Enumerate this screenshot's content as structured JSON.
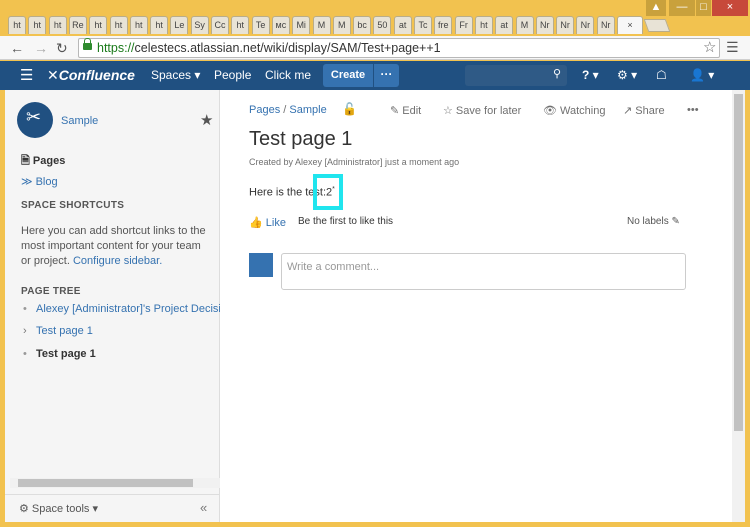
{
  "browser": {
    "tabs": [
      "ht",
      "ht",
      "ht",
      "Re",
      "ht",
      "ht",
      "ht",
      "ht",
      "Le",
      "Sy",
      "Cc",
      "ht",
      "Te",
      "мс",
      "Mi",
      "M",
      "M",
      "bc",
      "50",
      "at",
      "Tc",
      "fre",
      "Fr",
      "ht",
      "at",
      "M",
      "Nr",
      "Nr",
      "Nr",
      "Nr"
    ],
    "active_tab_close": "×",
    "url_scheme": "https://",
    "url_rest": "celestecs.atlassian.net/wiki/display/SAM/Test+page++1",
    "window_controls": [
      "▲",
      "—",
      "□",
      "×"
    ]
  },
  "header": {
    "logo": "Confluence",
    "spaces": "Spaces ▾",
    "people": "People",
    "click_me": "Click me",
    "create": "Create",
    "create_more": "···",
    "help": "? ▾",
    "settings": "⚙ ▾",
    "notifications": "☖",
    "user": "👤 ▾"
  },
  "sidebar": {
    "space_name": "Sample",
    "pages": "Pages",
    "blog": "Blog",
    "shortcuts_heading": "SPACE SHORTCUTS",
    "shortcuts_text": "Here you can add shortcut links to the most important content for your team or project.",
    "configure_sidebar": "Configure sidebar.",
    "page_tree_heading": "PAGE TREE",
    "tree_items": [
      "Alexey [Administrator]'s Project Decisio",
      "Test page 1",
      "Test page 1"
    ],
    "space_tools": "Space tools ▾",
    "collapse": "«"
  },
  "page": {
    "breadcrumb_pages": "Pages",
    "breadcrumb_sep": "/",
    "breadcrumb_space": "Sample",
    "edit": "Edit",
    "save_for_later": "Save for later",
    "watching": "Watching",
    "share": "Share",
    "more": "•••",
    "title": "Test page 1",
    "byline": "Created by Alexey [Administrator] just a moment ago",
    "body_text": "Here is the test:2",
    "body_sup": "*",
    "like": "Like",
    "like_hint": "Be the first to like this",
    "labels": "No labels",
    "comment_placeholder": "Write a comment..."
  },
  "colors": {
    "header_bg": "#205081",
    "button_bg": "#3572b0",
    "highlight": "#20e5ee",
    "chrome_frame": "#f2c24f"
  }
}
